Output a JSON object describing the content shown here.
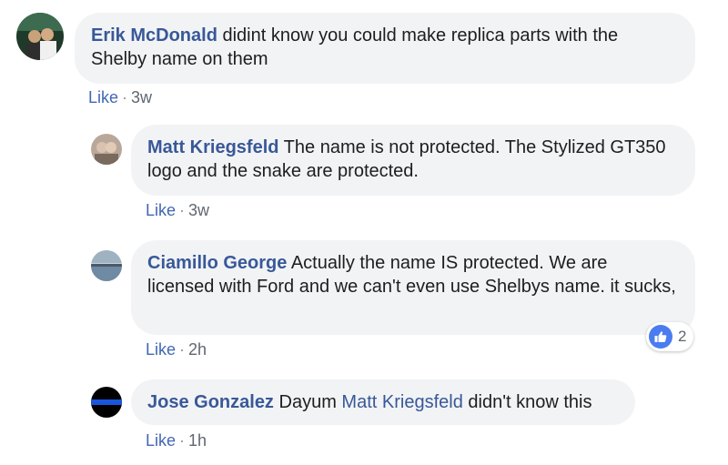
{
  "comments": [
    {
      "author": "Erik McDonald",
      "text": "didint know you could make replica parts with the Shelby name on them",
      "like_label": "Like",
      "time": "3w",
      "avatar_colors": [
        "#1f3a2a",
        "#3d6b4f",
        "#c9a27a"
      ]
    },
    {
      "author": "Matt Kriegsfeld",
      "text": "The name is not protected. The Stylized GT350 logo and the snake are protected.",
      "like_label": "Like",
      "time": "3w",
      "avatar_colors": [
        "#b9a89a",
        "#d9c2b0",
        "#7a6a5e"
      ]
    },
    {
      "author": "Ciamillo George",
      "text": "Actually the name IS protected. We are licensed with Ford and we can't even use Shelbys name. it sucks,",
      "like_label": "Like",
      "time": "2h",
      "reaction_count": "2",
      "reaction_icon": "thumbs-up-icon",
      "avatar_colors": [
        "#6f8aa3",
        "#c8d3dc",
        "#4a5a68"
      ]
    },
    {
      "author": "Jose Gonzalez",
      "text_before": "Dayum",
      "mention": "Matt Kriegsfeld",
      "text_after": "didn't know this",
      "like_label": "Like",
      "time": "1h",
      "avatar_colors": [
        "#000000",
        "#1a56db"
      ]
    }
  ],
  "colors": {
    "link": "#385898",
    "bubble": "#f2f3f5",
    "like": "#4267b2",
    "reaction": "#4a7cf0"
  }
}
